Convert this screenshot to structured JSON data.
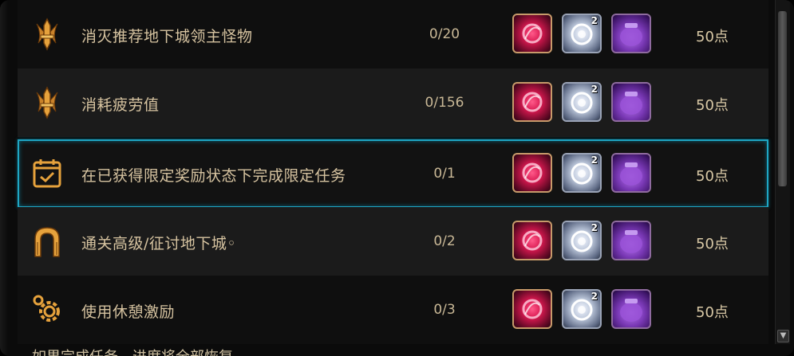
{
  "tasks": [
    {
      "icon": "sword-crest-icon",
      "title": "消灭推荐地下城领主怪物",
      "progress": "0/20",
      "points": "50点"
    },
    {
      "icon": "sword-crest-icon",
      "title": "消耗疲劳值",
      "progress": "0/156",
      "points": "50点"
    },
    {
      "icon": "calendar-check-icon",
      "title": "在已获得限定奖励状态下完成限定任务",
      "progress": "0/1",
      "points": "50点"
    },
    {
      "icon": "dungeon-gate-icon",
      "title": "通关高级/征讨地下城◦",
      "progress": "0/2",
      "points": "50点"
    },
    {
      "icon": "gear-icon",
      "title": "使用休憩激励",
      "progress": "0/3",
      "points": "50点"
    }
  ],
  "reward_count": "2",
  "footer": {
    "text": "如果完成任务，进度将全部恢复"
  },
  "colors": {
    "selected_border": "#1fa6c4",
    "text": "#d6c3a0",
    "icon": "#e0a040"
  }
}
